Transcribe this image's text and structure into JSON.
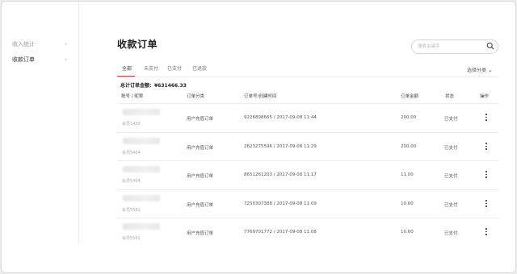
{
  "sidebar": {
    "items": [
      {
        "label": "收入统计",
        "active": false
      },
      {
        "label": "收款订单",
        "active": true
      }
    ]
  },
  "page_title": "收款订单",
  "search": {
    "placeholder": "搜索关键字",
    "value": ""
  },
  "tabs": [
    {
      "label": "全部",
      "active": true
    },
    {
      "label": "未支付",
      "active": false
    },
    {
      "label": "已支付",
      "active": false
    },
    {
      "label": "已退款",
      "active": false
    }
  ],
  "filter": {
    "label": "选择分类"
  },
  "total": {
    "text": "总计订单金额：¥631466.33"
  },
  "table": {
    "headers": [
      "账号 / 昵称",
      "订单分类",
      "订单号/创建时间",
      "订单金额",
      "状态",
      "操作"
    ],
    "rows": [
      {
        "nickname": "会员1459",
        "category": "用户充值订单",
        "order": "9226898665 / 2017-09-08 11:44",
        "amount": "200.00",
        "status": "已支付"
      },
      {
        "nickname": "会员5404",
        "category": "用户充值订单",
        "order": "2623275596 / 2017-09-08 11:29",
        "amount": "200.00",
        "status": "已支付"
      },
      {
        "nickname": "会员5404",
        "category": "用户充值订单",
        "order": "8651261203 / 2017-09-08 11:17",
        "amount": "11.00",
        "status": "已支付"
      },
      {
        "nickname": "会员5561",
        "category": "用户充值订单",
        "order": "7250307388 / 2017-09-08 11:09",
        "amount": "10.00",
        "status": "已支付"
      },
      {
        "nickname": "会员5561",
        "category": "用户充值订单",
        "order": "7769701772 / 2017-09-08 11:08",
        "amount": "10.00",
        "status": "已支付"
      }
    ]
  },
  "colors": {
    "accent": "#e53935",
    "text": "#333333",
    "muted": "#999999"
  },
  "icons": {
    "search": "search-icon",
    "more": "more-vertical-icon",
    "chevron": "chevron-right-icon"
  }
}
